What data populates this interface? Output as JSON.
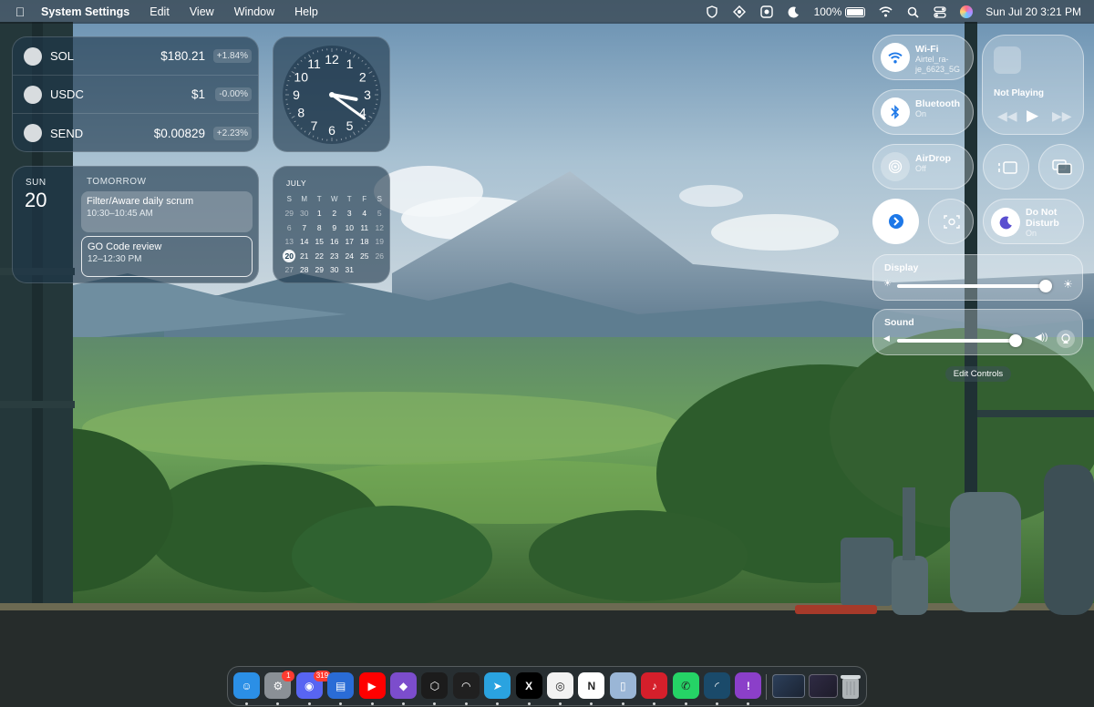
{
  "menubar": {
    "app_name": "System Settings",
    "menus": [
      "Edit",
      "View",
      "Window",
      "Help"
    ],
    "battery_percent": "100%",
    "datetime": "Sun Jul 20  3:21 PM"
  },
  "stocks": [
    {
      "symbol": "SOL",
      "price": "$180.21",
      "change": "+1.84%"
    },
    {
      "symbol": "USDC",
      "price": "$1",
      "change": "-0.00%"
    },
    {
      "symbol": "SEND",
      "price": "$0.00829",
      "change": "+2.23%"
    }
  ],
  "clock": {
    "numbers": [
      "12",
      "1",
      "2",
      "3",
      "4",
      "5",
      "6",
      "7",
      "8",
      "9",
      "10",
      "11"
    ],
    "hour": 3,
    "minute": 21
  },
  "calendar": {
    "day_name": "SUN",
    "day_number": "20",
    "section_title": "TOMORROW",
    "events": [
      {
        "title": "Filter/Aware daily scrum",
        "time": "10:30–10:45 AM"
      },
      {
        "title": "GO Code review",
        "time": "12–12:30 PM"
      }
    ]
  },
  "month": {
    "name": "JULY",
    "weekdays": [
      "S",
      "M",
      "T",
      "W",
      "T",
      "F",
      "S"
    ],
    "weeks": [
      [
        "29",
        "30",
        "1",
        "2",
        "3",
        "4",
        "5"
      ],
      [
        "6",
        "7",
        "8",
        "9",
        "10",
        "11",
        "12"
      ],
      [
        "13",
        "14",
        "15",
        "16",
        "17",
        "18",
        "19"
      ],
      [
        "20",
        "21",
        "22",
        "23",
        "24",
        "25",
        "26"
      ],
      [
        "27",
        "28",
        "29",
        "30",
        "31",
        "",
        ""
      ]
    ],
    "today": "20"
  },
  "control_center": {
    "wifi": {
      "label": "Wi-Fi",
      "sub": "Airtel_ra-je_6623_5G"
    },
    "bluetooth": {
      "label": "Bluetooth",
      "sub": "On"
    },
    "airdrop": {
      "label": "AirDrop",
      "sub": "Off"
    },
    "now_playing": {
      "title": "Not Playing"
    },
    "dnd": {
      "label": "Do Not Disturb",
      "sub": "On"
    },
    "display": {
      "title": "Display",
      "level": 0.93
    },
    "sound": {
      "title": "Sound",
      "level": 0.93
    },
    "edit_label": "Edit Controls"
  },
  "dock": {
    "apps": [
      {
        "name": "Finder",
        "color": "#2b8fe6"
      },
      {
        "name": "System Settings",
        "color": "#8a9096",
        "badge": "1"
      },
      {
        "name": "Discord",
        "color": "#5865f2",
        "badge": "319"
      },
      {
        "name": "Files",
        "color": "#2a6cd6"
      },
      {
        "name": "YouTube",
        "color": "#ff0000"
      },
      {
        "name": "Obsidian",
        "color": "#7c4dcc"
      },
      {
        "name": "Cursor",
        "color": "#1c1c1c"
      },
      {
        "name": "Warp",
        "color": "#202020"
      },
      {
        "name": "Telegram",
        "color": "#2aa3e0"
      },
      {
        "name": "X",
        "color": "#000000"
      },
      {
        "name": "Chrome",
        "color": "#f2f2f2"
      },
      {
        "name": "Notion",
        "color": "#ffffff"
      },
      {
        "name": "Preview",
        "color": "#9ab6d6"
      },
      {
        "name": "Music",
        "color": "#d51f2b"
      },
      {
        "name": "WhatsApp",
        "color": "#25d366"
      },
      {
        "name": "Arc",
        "color": "#1a4a6a"
      },
      {
        "name": "Feedback",
        "color": "#8b3fc9"
      }
    ]
  }
}
